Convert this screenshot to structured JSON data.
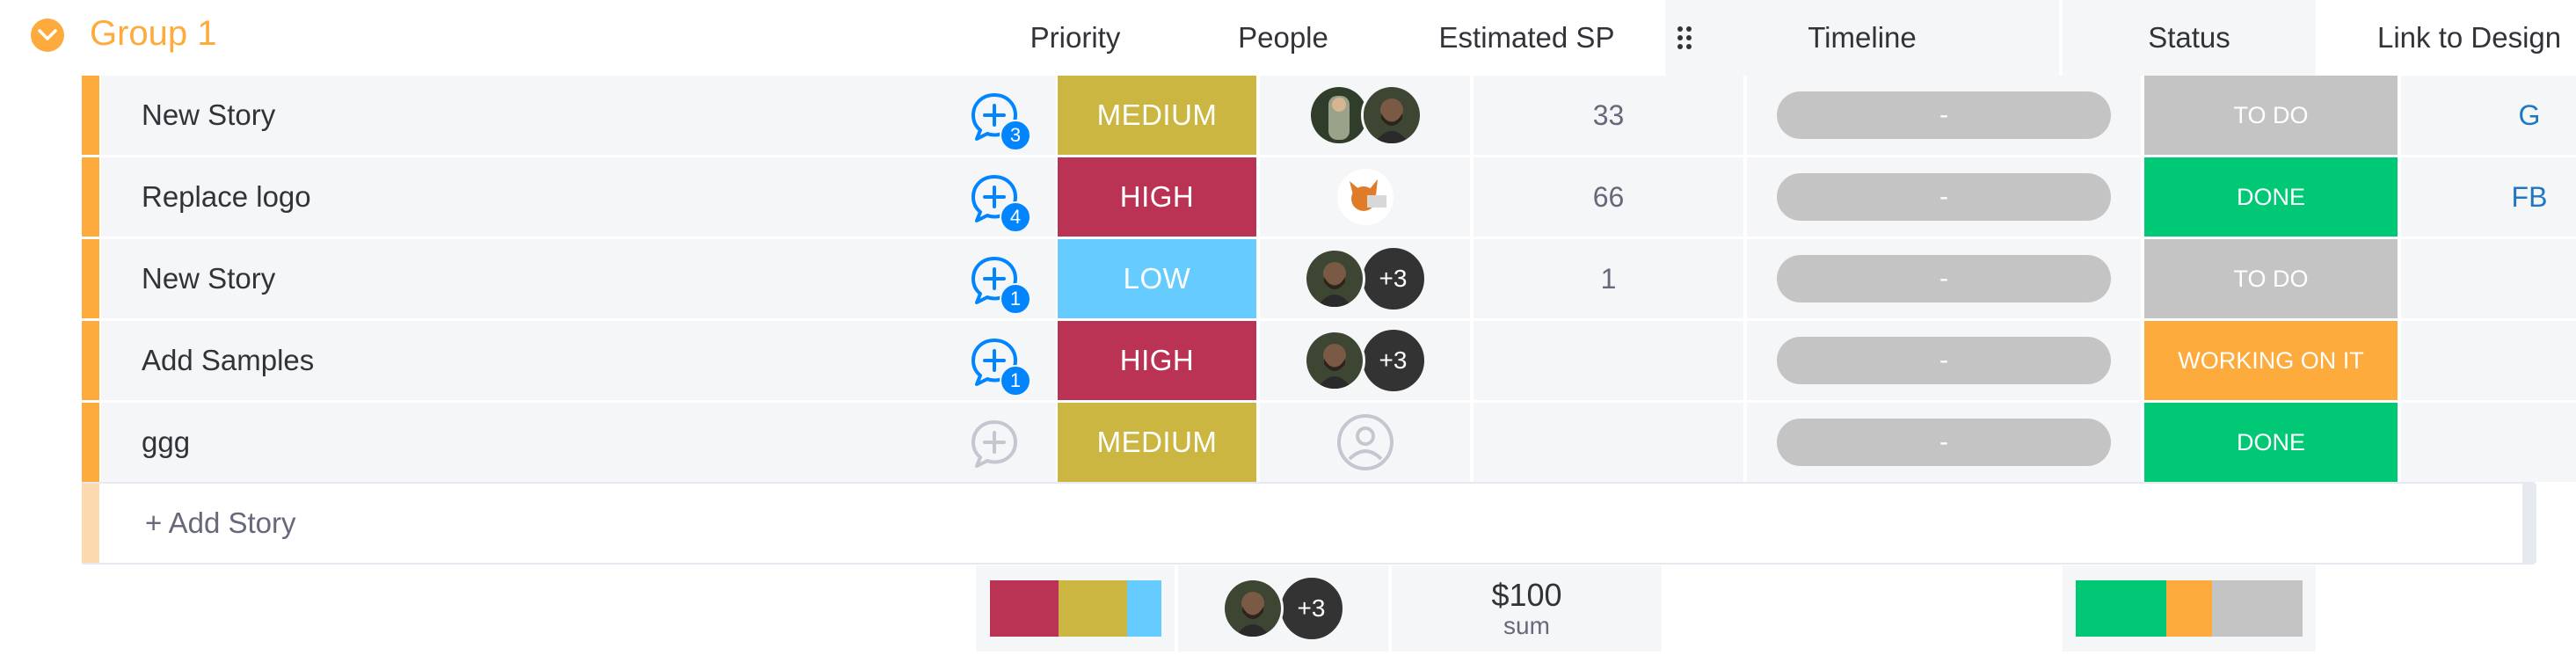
{
  "group": {
    "title": "Group 1",
    "color": "#fdab3d"
  },
  "columns": {
    "priority": "Priority",
    "people": "People",
    "estimated_sp": "Estimated SP",
    "timeline": "Timeline",
    "status": "Status",
    "link": "Link to Design"
  },
  "rows": [
    {
      "name": "New Story",
      "updates": "3",
      "priority": "MEDIUM",
      "priority_color": "#cab641",
      "people_extra": "",
      "sp": "33",
      "timeline": "-",
      "status": "TO DO",
      "status_color": "#c4c4c4",
      "link": "G"
    },
    {
      "name": "Replace logo",
      "updates": "4",
      "priority": "HIGH",
      "priority_color": "#bb3354",
      "people_extra": "",
      "sp": "66",
      "timeline": "-",
      "status": "DONE",
      "status_color": "#00c875",
      "link": "FB"
    },
    {
      "name": "New Story",
      "updates": "1",
      "priority": "LOW",
      "priority_color": "#66ccff",
      "people_extra": "+3",
      "sp": "1",
      "timeline": "-",
      "status": "TO DO",
      "status_color": "#c4c4c4",
      "link": ""
    },
    {
      "name": "Add Samples",
      "updates": "1",
      "priority": "HIGH",
      "priority_color": "#bb3354",
      "people_extra": "+3",
      "sp": "",
      "timeline": "-",
      "status": "WORKING ON IT",
      "status_color": "#fdab3d",
      "link": ""
    },
    {
      "name": "ggg",
      "updates": "",
      "priority": "MEDIUM",
      "priority_color": "#cab641",
      "people_extra": "",
      "sp": "",
      "timeline": "-",
      "status": "DONE",
      "status_color": "#00c875",
      "link": ""
    }
  ],
  "add_row": {
    "label": "+ Add Story"
  },
  "footer": {
    "priority_distribution": [
      {
        "color": "#bb3354",
        "fraction": 0.4
      },
      {
        "color": "#cab641",
        "fraction": 0.4
      },
      {
        "color": "#66ccff",
        "fraction": 0.2
      }
    ],
    "people_extra": "+3",
    "sp_sum": "$100",
    "sp_sum_label": "sum",
    "status_distribution": [
      {
        "color": "#00c875",
        "fraction": 0.4
      },
      {
        "color": "#fdab3d",
        "fraction": 0.2
      },
      {
        "color": "#c4c4c4",
        "fraction": 0.4
      }
    ]
  }
}
